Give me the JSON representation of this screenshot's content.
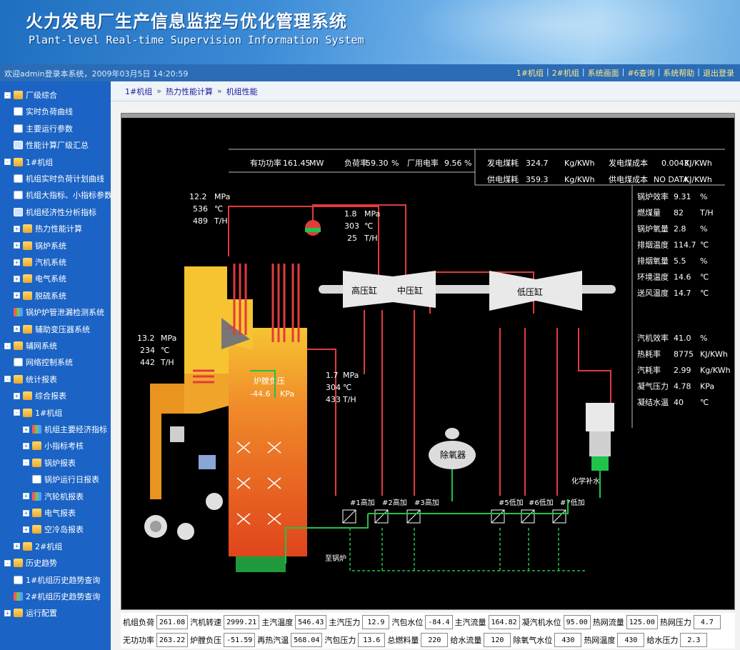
{
  "header": {
    "title_cn": "火力发电厂生产信息监控与优化管理系统",
    "title_en": "Plant-level Real-time Supervision Information System"
  },
  "status": {
    "welcome": "欢迎admin登录本系统，2009年03月5日 14:20:59",
    "nav": [
      "1#机组",
      "2#机组",
      "系统画面",
      "#6查询",
      "系统帮助",
      "退出登录"
    ]
  },
  "sidebar": {
    "items": [
      {
        "label": "厂级综合",
        "level": 0,
        "pm": "-",
        "icon": "folder-icon"
      },
      {
        "label": "实时负荷曲线",
        "level": 1,
        "pm": "",
        "icon": "doc-icon"
      },
      {
        "label": "主要运行参数",
        "level": 1,
        "pm": "",
        "icon": "doc-icon"
      },
      {
        "label": "性能计算厂级汇总",
        "level": 1,
        "pm": "",
        "icon": "screen-icon"
      },
      {
        "label": "1#机组",
        "level": 0,
        "pm": "-",
        "icon": "folder-icon"
      },
      {
        "label": "机组实时负荷计划曲线",
        "level": 1,
        "pm": "",
        "icon": "doc-icon"
      },
      {
        "label": "机组大指标、小指标参数",
        "level": 1,
        "pm": "",
        "icon": "doc-icon"
      },
      {
        "label": "机组经济性分析指标",
        "level": 1,
        "pm": "",
        "icon": "screen-icon"
      },
      {
        "label": "热力性能计算",
        "level": 1,
        "pm": "+",
        "icon": "folder-icon"
      },
      {
        "label": "锅炉系统",
        "level": 1,
        "pm": "+",
        "icon": "folder-icon"
      },
      {
        "label": "汽机系统",
        "level": 1,
        "pm": "+",
        "icon": "folder-icon"
      },
      {
        "label": "电气系统",
        "level": 1,
        "pm": "+",
        "icon": "folder-icon"
      },
      {
        "label": "脱硫系统",
        "level": 1,
        "pm": "+",
        "icon": "folder-icon"
      },
      {
        "label": "锅炉炉管泄漏检测系统",
        "level": 1,
        "pm": "",
        "icon": "chart-icon"
      },
      {
        "label": "辅助变压器系统",
        "level": 1,
        "pm": "+",
        "icon": "folder-icon"
      },
      {
        "label": "辅网系统",
        "level": 0,
        "pm": "-",
        "icon": "folder-icon"
      },
      {
        "label": "网络控制系统",
        "level": 1,
        "pm": "",
        "icon": "doc-icon"
      },
      {
        "label": "统计报表",
        "level": 0,
        "pm": "-",
        "icon": "folder-icon"
      },
      {
        "label": "综合报表",
        "level": 1,
        "pm": "+",
        "icon": "folder-icon"
      },
      {
        "label": "1#机组",
        "level": 1,
        "pm": "-",
        "icon": "folder-icon"
      },
      {
        "label": "机组主要经济指标",
        "level": 2,
        "pm": "+",
        "icon": "chart-icon"
      },
      {
        "label": "小指标考核",
        "level": 2,
        "pm": "+",
        "icon": "folder-icon"
      },
      {
        "label": "锅炉报表",
        "level": 2,
        "pm": "-",
        "icon": "folder-icon"
      },
      {
        "label": "锅炉运行日报表",
        "level": 3,
        "pm": "",
        "icon": "doc-icon"
      },
      {
        "label": "汽轮机报表",
        "level": 2,
        "pm": "+",
        "icon": "chart-icon"
      },
      {
        "label": "电气报表",
        "level": 2,
        "pm": "+",
        "icon": "folder-icon"
      },
      {
        "label": "空冷岛报表",
        "level": 2,
        "pm": "+",
        "icon": "folder-icon"
      },
      {
        "label": "2#机组",
        "level": 1,
        "pm": "+",
        "icon": "folder-icon"
      },
      {
        "label": "历史趋势",
        "level": 0,
        "pm": "-",
        "icon": "folder-icon"
      },
      {
        "label": "1#机组历史趋势查询",
        "level": 1,
        "pm": "",
        "icon": "doc-icon"
      },
      {
        "label": "2#机组历史趋势查询",
        "level": 1,
        "pm": "",
        "icon": "chart-icon"
      },
      {
        "label": "运行配置",
        "level": 0,
        "pm": "+",
        "icon": "folder-icon"
      }
    ]
  },
  "breadcrumb": [
    "1#机组",
    "热力性能计算",
    "机组性能"
  ],
  "summary": {
    "power_label": "有功功率",
    "power_value": "161.45",
    "power_unit": "MW",
    "load_label": "负荷率",
    "load_value": "59.30",
    "load_unit": "%",
    "plant_label": "厂用电率",
    "plant_value": "9.56",
    "plant_unit": "%"
  },
  "coal": {
    "gen_label": "发电煤耗",
    "gen_value": "324.7",
    "gen_unit": "Kg/KWh",
    "gencost_label": "发电煤成本",
    "gencost_value": "0.0043",
    "gencost_unit": "KJ/KWh",
    "sup_label": "供电煤耗",
    "sup_value": "359.3",
    "sup_unit": "Kg/KWh",
    "supcost_label": "供电煤成本",
    "supcost_value": "NO DATA",
    "supcost_unit": "KJ/KWh"
  },
  "boiler_params": [
    {
      "label": "锅炉效率",
      "value": "9.31",
      "unit": "%"
    },
    {
      "label": "燃煤量",
      "value": "82",
      "unit": "T/H"
    },
    {
      "label": "锅炉氧量",
      "value": "2.8",
      "unit": "%"
    },
    {
      "label": "排烟温度",
      "value": "114.7",
      "unit": "℃"
    },
    {
      "label": "排烟氧量",
      "value": "5.5",
      "unit": "%"
    },
    {
      "label": "环境温度",
      "value": "14.6",
      "unit": "℃"
    },
    {
      "label": "送风温度",
      "value": "14.7",
      "unit": "℃"
    }
  ],
  "turbine_params": [
    {
      "label": "汽机效率",
      "value": "41.0",
      "unit": "%"
    },
    {
      "label": "热耗率",
      "value": "8775",
      "unit": "KJ/KWh"
    },
    {
      "label": "汽耗率",
      "value": "2.99",
      "unit": "Kg/KWh"
    },
    {
      "label": "凝气压力",
      "value": "4.78",
      "unit": "KPa"
    },
    {
      "label": "凝结水温",
      "value": "40",
      "unit": "℃"
    }
  ],
  "diagram": {
    "main_steam": {
      "p": "12.2",
      "p_unit": "MPa",
      "t": "536",
      "t_unit": "℃",
      "f": "489",
      "f_unit": "T/H"
    },
    "reheat_out": {
      "p": "1.8",
      "p_unit": "MPa",
      "t": "303",
      "t_unit": "℃",
      "f": "25",
      "f_unit": "T/H"
    },
    "feed": {
      "p": "13.2",
      "p_unit": "MPa",
      "t": "234",
      "t_unit": "℃",
      "f": "442",
      "f_unit": "T/H"
    },
    "reheat_in": {
      "p": "1.7",
      "p_unit": "MPa",
      "t": "304",
      "t_unit": "℃",
      "f": "433",
      "f_unit": "T/H"
    },
    "furnace_label": "炉膛负压",
    "furnace_value": "-44.6",
    "furnace_unit": "KPa",
    "hp": "高压缸",
    "ip": "中压缸",
    "lp": "低压缸",
    "deaerator": "除氧器",
    "heaters_hp": [
      "#1高加",
      "#2高加",
      "#3高加"
    ],
    "heaters_lp": [
      "#5低加",
      "#6低加",
      "#7低加"
    ],
    "makeup": "化学补水",
    "to_boiler": "至锅炉"
  },
  "bottom_rows": [
    [
      {
        "label": "机组负荷",
        "value": "261.08"
      },
      {
        "label": "汽机转速",
        "value": "2999.21"
      },
      {
        "label": "主汽温度",
        "value": "546.43"
      },
      {
        "label": "主汽压力",
        "value": "12.9"
      },
      {
        "label": "汽包水位",
        "value": "-84.4"
      },
      {
        "label": "主汽流量",
        "value": "164.82"
      },
      {
        "label": "凝汽机水位",
        "value": "95.00"
      },
      {
        "label": "热网流量",
        "value": "125.00"
      },
      {
        "label": "热网压力",
        "value": "4.7"
      }
    ],
    [
      {
        "label": "无功功率",
        "value": "263.22"
      },
      {
        "label": "炉膛负压",
        "value": "-51.59"
      },
      {
        "label": "再热汽温",
        "value": "568.04"
      },
      {
        "label": "汽包压力",
        "value": "13.6"
      },
      {
        "label": "总燃料量",
        "value": "220"
      },
      {
        "label": "给水流量",
        "value": "120"
      },
      {
        "label": "除氧气水位",
        "value": "430"
      },
      {
        "label": "热网温度",
        "value": "430"
      },
      {
        "label": "给水压力",
        "value": "2.3"
      }
    ]
  ],
  "colors": {
    "header_blue": "#1f6fc0",
    "sidebar_blue": "#1b63c4",
    "steam_red": "#e23b3b",
    "water_green": "#21c24a"
  }
}
